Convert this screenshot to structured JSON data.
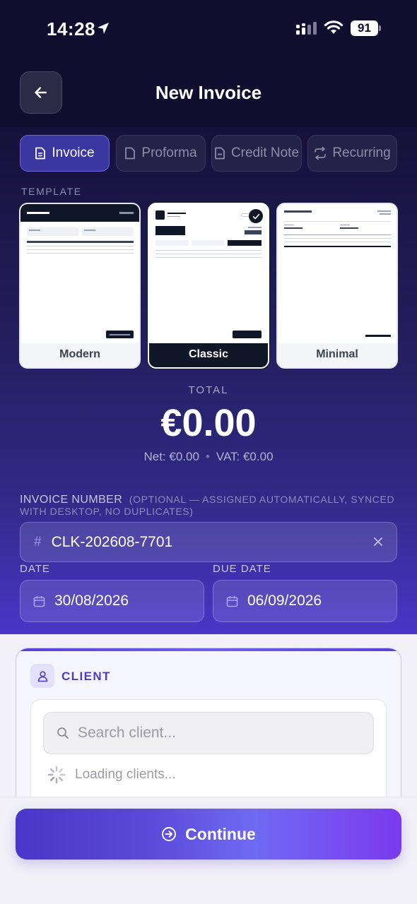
{
  "status_bar": {
    "time": "14:28",
    "battery": "91"
  },
  "header": {
    "title": "New Invoice"
  },
  "tabs": [
    {
      "label": "Invoice",
      "active": true
    },
    {
      "label": "Proforma",
      "active": false
    },
    {
      "label": "Credit Note",
      "active": false
    },
    {
      "label": "Recurring",
      "active": false
    }
  ],
  "template": {
    "section_label": "TEMPLATE",
    "options": [
      {
        "name": "Modern",
        "selected": false
      },
      {
        "name": "Classic",
        "selected": true
      },
      {
        "name": "Minimal",
        "selected": false
      }
    ]
  },
  "totals": {
    "label": "TOTAL",
    "amount": "€0.00",
    "net": "Net: €0.00",
    "separator": "•",
    "vat": "VAT: €0.00"
  },
  "invoice_number": {
    "label": "INVOICE NUMBER",
    "hint": "(OPTIONAL — ASSIGNED AUTOMATICALLY, SYNCED WITH DESKTOP, NO DUPLICATES)",
    "prefix": "#",
    "value": "CLK-202608-7701"
  },
  "dates": {
    "date_label": "DATE",
    "date_value": "30/08/2026",
    "due_label": "DUE DATE",
    "due_value": "06/09/2026"
  },
  "client": {
    "title": "CLIENT",
    "search_placeholder": "Search client...",
    "loading_text": "Loading clients..."
  },
  "footer": {
    "continue_label": "Continue"
  },
  "colors": {
    "accent": "#4a36c8",
    "accent_end": "#7c3aed",
    "header_bg": "#110d2e"
  }
}
